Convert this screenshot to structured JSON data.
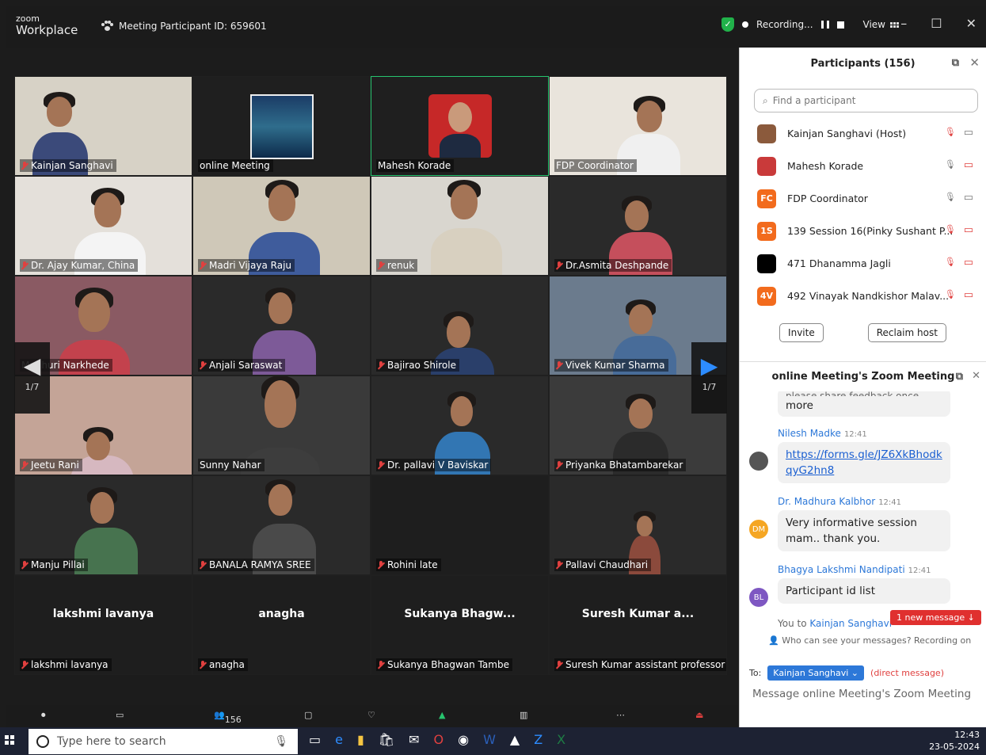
{
  "app": {
    "brand_line1": "zoom",
    "brand_line2": "Workplace",
    "meeting_id": "Meeting Participant ID: 659601",
    "recording": "Recording...",
    "view": "View"
  },
  "tiles": [
    {
      "name": "Kainjan Sanghavi",
      "muted": true
    },
    {
      "name": "online Meeting",
      "muted": false
    },
    {
      "name": "Mahesh Korade",
      "muted": false,
      "active": true
    },
    {
      "name": "FDP Coordinator",
      "muted": false
    },
    {
      "name": "Dr. Ajay Kumar, China",
      "muted": true
    },
    {
      "name": "Madri Vijaya Raju",
      "muted": true
    },
    {
      "name": "renuk",
      "muted": true
    },
    {
      "name": "Dr.Asmita Deshpande",
      "muted": true
    },
    {
      "name": "Madhuri Narkhede",
      "muted": false
    },
    {
      "name": "Anjali Saraswat",
      "muted": true
    },
    {
      "name": "Bajirao Shirole",
      "muted": true
    },
    {
      "name": "Vivek Kumar Sharma",
      "muted": true
    },
    {
      "name": "Jeetu Rani",
      "muted": true
    },
    {
      "name": "Sunny Nahar",
      "muted": false
    },
    {
      "name": "Dr. pallavi V Baviskar",
      "muted": true
    },
    {
      "name": "Priyanka Bhatambarekar",
      "muted": true
    },
    {
      "name": "Manju Pillai",
      "muted": true
    },
    {
      "name": "BANALA RAMYA SREE",
      "muted": true
    },
    {
      "name": "Rohini late",
      "muted": true
    },
    {
      "name": "Pallavi Chaudhari",
      "muted": true
    },
    {
      "name": "lakshmi lavanya",
      "muted": true,
      "big": "lakshmi lavanya"
    },
    {
      "name": "anagha",
      "muted": true,
      "big": "anagha"
    },
    {
      "name": "Sukanya Bhagwan Tambe",
      "muted": true,
      "big": "Sukanya  Bhagw..."
    },
    {
      "name": "Suresh Kumar assistant professor",
      "muted": true,
      "big": "Suresh Kumar a..."
    }
  ],
  "pager": {
    "left": "1/7",
    "right": "1/7"
  },
  "toolbar": {
    "participants_count": "156"
  },
  "participants_panel": {
    "title": "Participants (156)",
    "search_placeholder": "Find a participant",
    "items": [
      {
        "name": "Kainjan Sanghavi (Host)",
        "avatar": "",
        "avatar_color": "#8b5a3c"
      },
      {
        "name": "Mahesh Korade",
        "avatar": "",
        "avatar_color": "#c93a3a"
      },
      {
        "name": "FDP Coordinator",
        "avatar": "FC",
        "avatar_color": "#f26b1d"
      },
      {
        "name": "139 Session 16(Pinky Sushant P...",
        "avatar": "1S",
        "avatar_color": "#f26b1d"
      },
      {
        "name": "471 Dhanamma Jagli",
        "avatar": "",
        "avatar_color": "#000000"
      },
      {
        "name": "492 Vinayak Nandkishor Malav...",
        "avatar": "4V",
        "avatar_color": "#f26b1d"
      }
    ],
    "invite": "Invite",
    "reclaim": "Reclaim host"
  },
  "chat": {
    "title": "online Meeting's Zoom Meeting",
    "partial_top": "please share feedback once",
    "partial_more": "more",
    "messages": [
      {
        "sender": "Nilesh Madke",
        "time": "12:41",
        "text": "https://forms.gle/JZ6XkBhodkqyG2hn8",
        "link": true,
        "avatar": "",
        "avatar_color": "#555"
      },
      {
        "sender": "Dr. Madhura Kalbhor",
        "time": "12:41",
        "text": "Very informative session mam.. thank you.",
        "link": false,
        "avatar": "DM",
        "avatar_color": "#f5a623"
      },
      {
        "sender": "Bhagya Lakshmi Nandipati",
        "time": "12:41",
        "text": "Participant id list",
        "link": false,
        "avatar": "BL",
        "avatar_color": "#7e57c2"
      }
    ],
    "you_to_prefix": "You to",
    "you_to_name": "Kainjan Sanghavi",
    "new_message": "1 new message",
    "who_can_see": "Who can see your messages? Recording on",
    "to_label": "To:",
    "to_recipient": "Kainjan Sanghavi",
    "direct": "(direct message)",
    "input_placeholder": "Message online Meeting's Zoom Meeting"
  },
  "taskbar": {
    "search": "Type here to search",
    "time": "12:43",
    "date": "23-05-2024"
  },
  "colors": {
    "accent": "#2d8cff",
    "muted_red": "#e0403f",
    "active_border": "#27c46e"
  }
}
